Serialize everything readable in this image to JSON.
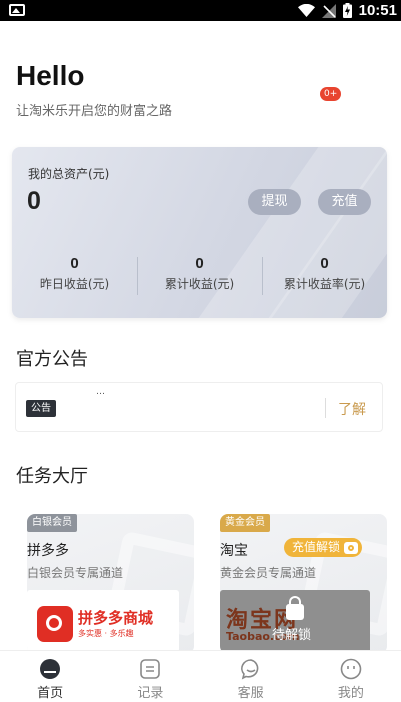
{
  "status_bar": {
    "time": "10:51"
  },
  "header": {
    "title": "Hello",
    "subtitle": "让淘米乐开启您的财富之路",
    "notification_badge": "0+"
  },
  "assets": {
    "label": "我的总资产(元)",
    "value": "0",
    "withdraw_label": "提现",
    "recharge_label": "充值",
    "stats": [
      {
        "value": "0",
        "label": "昨日收益(元)"
      },
      {
        "value": "0",
        "label": "累计收益(元)"
      },
      {
        "value": "0",
        "label": "累计收益率(元)"
      }
    ]
  },
  "announcement": {
    "section_title": "官方公告",
    "tag": "公告",
    "text": "…",
    "link": "了解"
  },
  "tasks": {
    "section_title": "任务大厅",
    "cards": [
      {
        "tier": "白银会员",
        "name": "拼多多",
        "desc": "白银会员专属通道",
        "banner_title": "拼多多商城",
        "banner_slogan": "多实惠 · 多乐趣"
      },
      {
        "tier": "黄金会员",
        "name": "淘宝",
        "desc": "黄金会员专属通道",
        "unlock_label": "充值解锁",
        "banner_title": "淘宝网",
        "banner_url": "Taobao.com",
        "lock_text": "待解锁"
      }
    ]
  },
  "tabbar": {
    "items": [
      {
        "label": "首页",
        "icon": "home-icon"
      },
      {
        "label": "记录",
        "icon": "record-icon"
      },
      {
        "label": "客服",
        "icon": "chat-icon"
      },
      {
        "label": "我的",
        "icon": "profile-icon"
      }
    ]
  },
  "colors": {
    "accent_gold": "#c99a4e",
    "badge_red": "#e8442f",
    "pdd_red": "#e02e24"
  }
}
